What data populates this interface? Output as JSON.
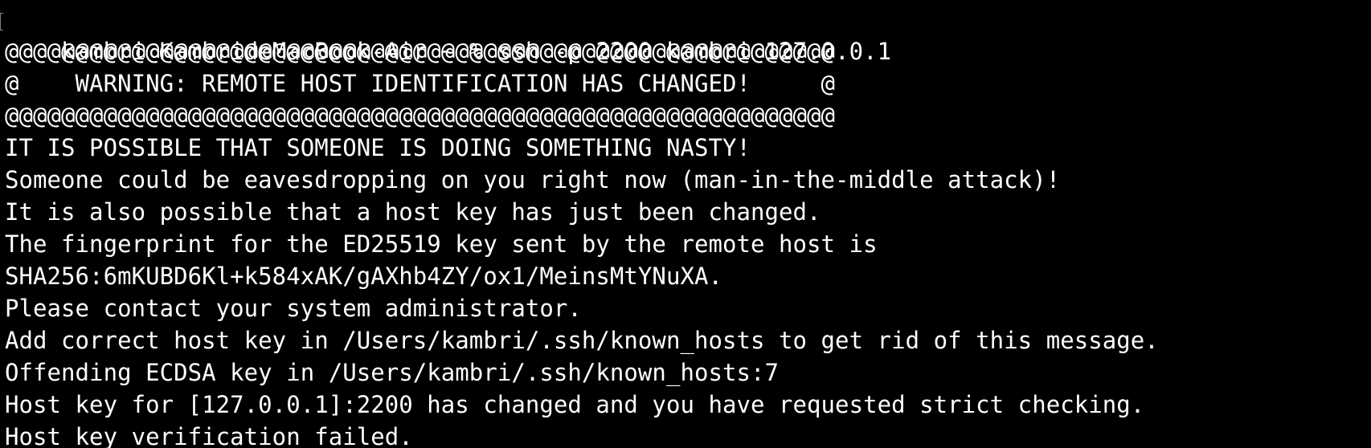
{
  "terminal": {
    "background": "#000000",
    "foreground": "#ffffff",
    "lines": [
      "kambri@KambrideMacBook-Air ~ % ssh -p 2200 kambri@127.0.0.1",
      "@@@@@@@@@@@@@@@@@@@@@@@@@@@@@@@@@@@@@@@@@@@@@@@@@@@@@@@@@@@",
      "@    WARNING: REMOTE HOST IDENTIFICATION HAS CHANGED!     @",
      "@@@@@@@@@@@@@@@@@@@@@@@@@@@@@@@@@@@@@@@@@@@@@@@@@@@@@@@@@@@",
      "IT IS POSSIBLE THAT SOMEONE IS DOING SOMETHING NASTY!",
      "Someone could be eavesdropping on you right now (man-in-the-middle attack)!",
      "It is also possible that a host key has just been changed.",
      "The fingerprint for the ED25519 key sent by the remote host is",
      "SHA256:6mKUBD6Kl+k584xAK/gAXhb4ZY/ox1/MeinsMtYNuXA.",
      "Please contact your system administrator.",
      "Add correct host key in /Users/kambri/.ssh/known_hosts to get rid of this message.",
      "Offending ECDSA key in /Users/kambri/.ssh/known_hosts:7",
      "Host key for [127.0.0.1]:2200 has changed and you have requested strict checking.",
      "Host key verification failed."
    ]
  }
}
